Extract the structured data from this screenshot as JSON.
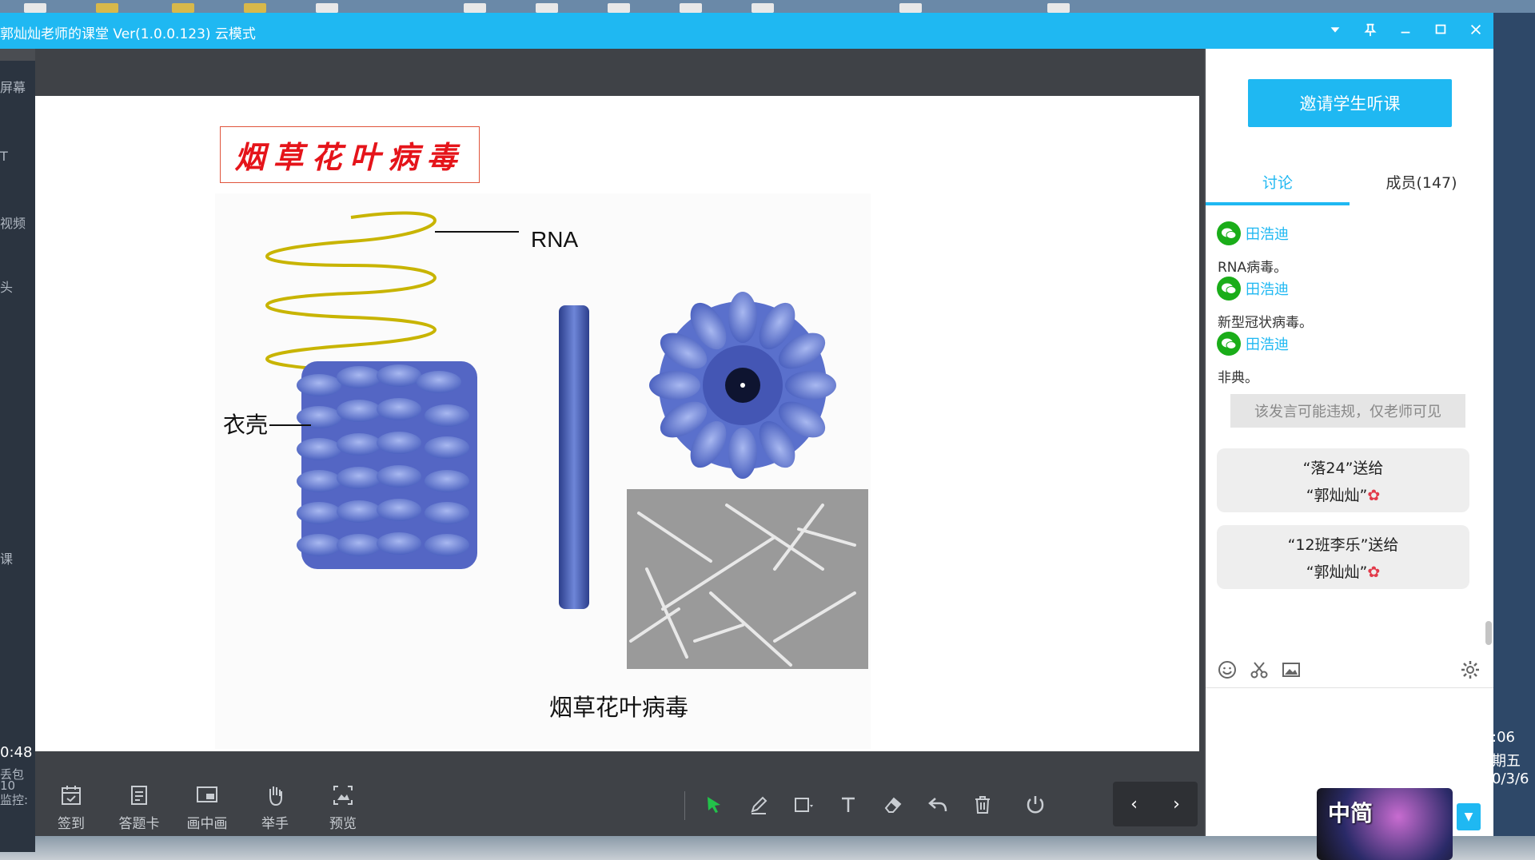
{
  "window": {
    "title": "郭灿灿老师的课堂 Ver(1.0.0.123)  云模式"
  },
  "slide": {
    "title": "烟草花叶病毒",
    "labels": {
      "rna": "RNA",
      "coat": "衣壳",
      "caption": "烟草花叶病毒"
    }
  },
  "toolbar": {
    "tools": [
      {
        "label": "签到",
        "icon": "calendar-check-icon"
      },
      {
        "label": "答题卡",
        "icon": "answer-card-icon"
      },
      {
        "label": "画中画",
        "icon": "picture-in-picture-icon"
      },
      {
        "label": "举手",
        "icon": "raise-hand-icon"
      },
      {
        "label": "预览",
        "icon": "preview-icon"
      }
    ],
    "nav": {
      "prev": "‹",
      "next": "›"
    }
  },
  "panel": {
    "invite_label": "邀请学生听课",
    "tabs": [
      {
        "label": "讨论",
        "active": true
      },
      {
        "label": "成员(147)",
        "active": false
      }
    ],
    "messages": [
      {
        "name": "田浩迪",
        "text": "RNA病毒。"
      },
      {
        "name": "田浩迪",
        "text": "新型冠状病毒。"
      },
      {
        "name": "田浩迪",
        "text": "非典。"
      }
    ],
    "warning": "该发言可能违规，仅老师可见",
    "gifts": [
      {
        "line1": "“落24”送给",
        "line2": "“郭灿灿”"
      },
      {
        "line1": "“12班李乐”送给",
        "line2": "“郭灿灿”"
      }
    ]
  },
  "desktop": {
    "left_items": [
      "屏幕",
      "T",
      "视频",
      "头",
      "课"
    ],
    "left_time": "0:48",
    "left_bottom": [
      "丢包",
      "10",
      "监控:"
    ],
    "right_clock": [
      ":06",
      "期五",
      "0/3/6"
    ],
    "thumb_label": "中简"
  },
  "colors": {
    "accent": "#1fb8f2",
    "title_red": "#e5141a",
    "wechat_green": "#1aad19",
    "active_tool_green": "#22c24a"
  }
}
